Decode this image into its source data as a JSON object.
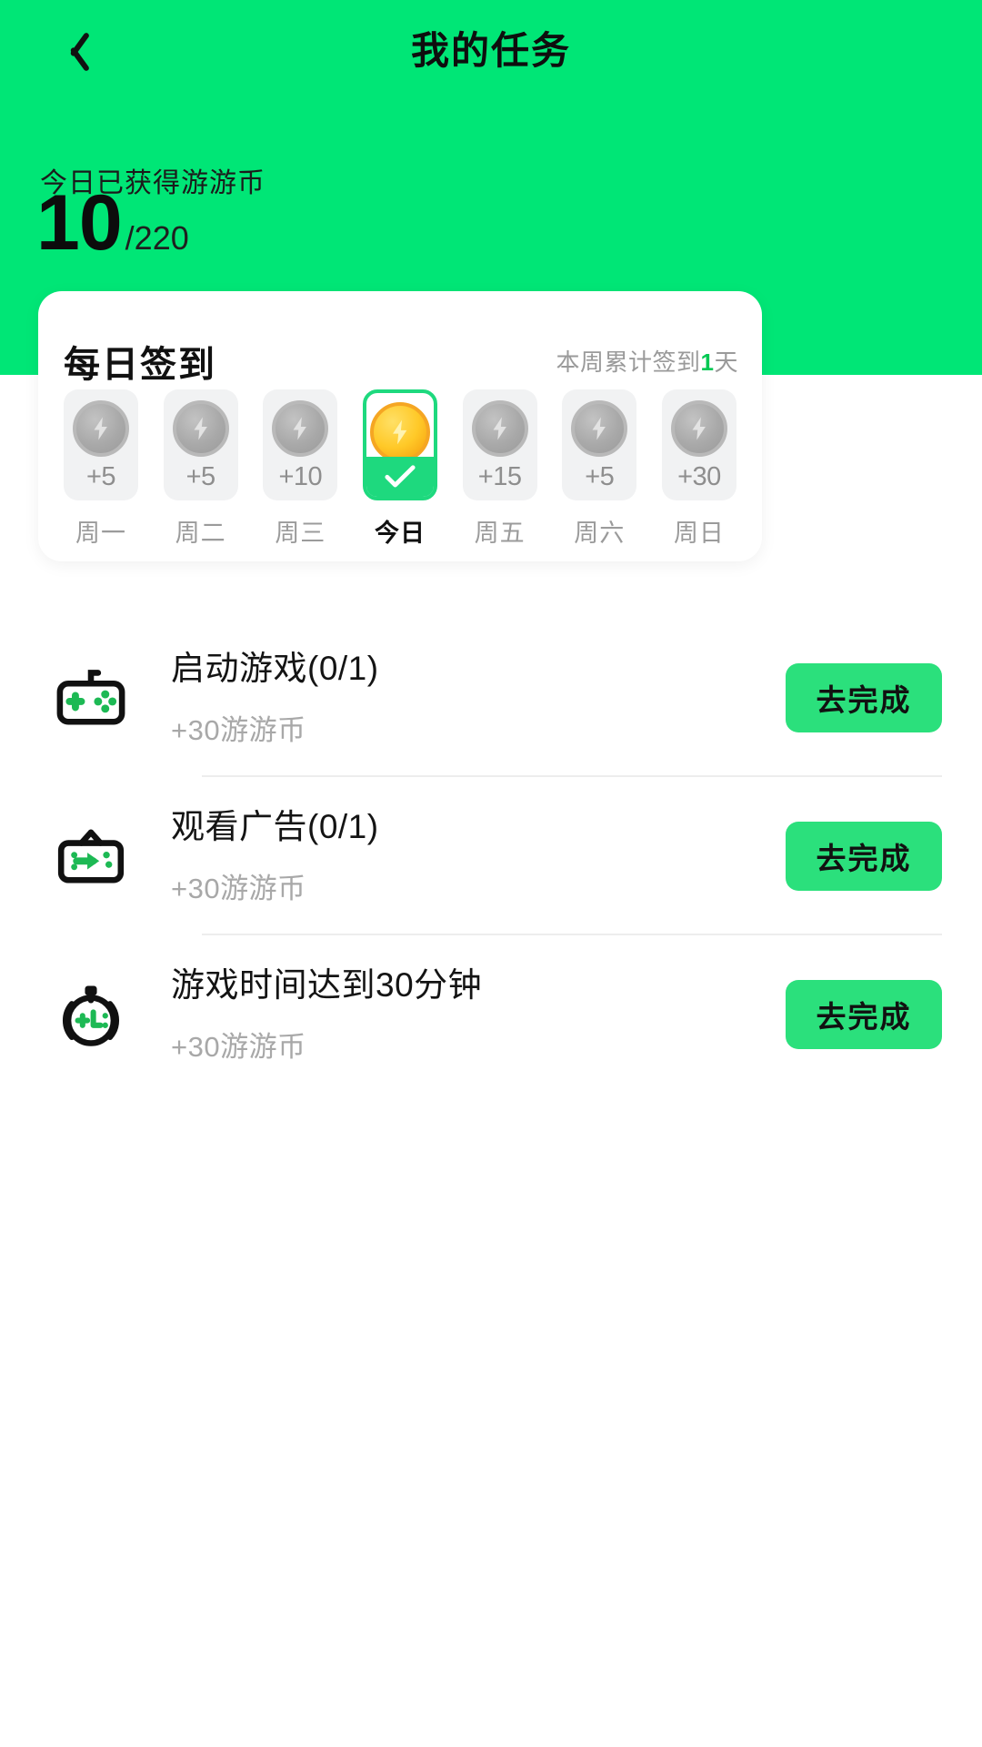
{
  "nav": {
    "back_icon": "chevron-left-icon",
    "title": "我的任务"
  },
  "hero": {
    "label": "今日已获得游游币",
    "earned": "10",
    "total": "/220",
    "bg_color": "#00E676"
  },
  "checkin": {
    "title": "每日签到",
    "summary_prefix": "本周累计签到",
    "summary_count": "1",
    "summary_suffix": "天",
    "days": [
      {
        "value": "+5",
        "name": "周一",
        "state": "locked"
      },
      {
        "value": "+5",
        "name": "周二",
        "state": "locked"
      },
      {
        "value": "+10",
        "name": "周三",
        "state": "locked"
      },
      {
        "value": "",
        "name": "今日",
        "state": "today",
        "check_icon": "check-icon"
      },
      {
        "value": "+15",
        "name": "周五",
        "state": "locked"
      },
      {
        "value": "+5",
        "name": "周六",
        "state": "locked"
      },
      {
        "value": "+30",
        "name": "周日",
        "state": "locked"
      }
    ]
  },
  "tasks": [
    {
      "icon": "gamepad-icon",
      "title": "启动游戏(0/1)",
      "reward": "+30游游币",
      "button": "去完成"
    },
    {
      "icon": "tv-icon",
      "title": "观看广告(0/1)",
      "reward": "+30游游币",
      "button": "去完成"
    },
    {
      "icon": "stopwatch-icon",
      "title": "游戏时间达到30分钟",
      "reward": "+30游游币",
      "button": "去完成"
    }
  ],
  "colors": {
    "accent": "#00E676",
    "button": "#2BE07C",
    "today_border": "#1ED97E",
    "coin_gold": "#FFC928",
    "muted": "#9b9b9b"
  }
}
